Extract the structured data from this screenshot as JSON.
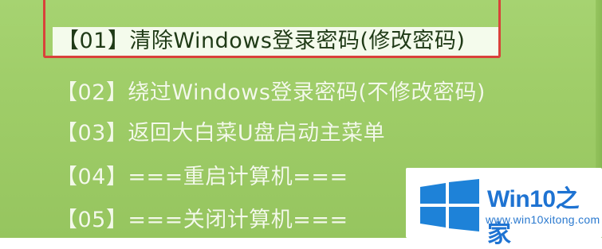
{
  "menu": {
    "items": [
      {
        "label": "【01】清除Windows登录密码(修改密码)",
        "selected": true
      },
      {
        "label": "【02】绕过Windows登录密码(不修改密码)",
        "selected": false
      },
      {
        "label": "【03】返回大白菜U盘启动主菜单",
        "selected": false
      },
      {
        "label": "【04】===重启计算机===",
        "selected": false
      },
      {
        "label": "【05】===关闭计算机===",
        "selected": false
      }
    ]
  },
  "watermark": {
    "title_win": "Win10",
    "title_suffix": "之家",
    "url": "www.win10xitong.com",
    "logo_icon": "windows-logo-icon"
  },
  "colors": {
    "background": "#9fcd68",
    "selected_text": "#1f3a16",
    "selection_border": "#d9423a",
    "brand_blue": "#1e73d2"
  }
}
